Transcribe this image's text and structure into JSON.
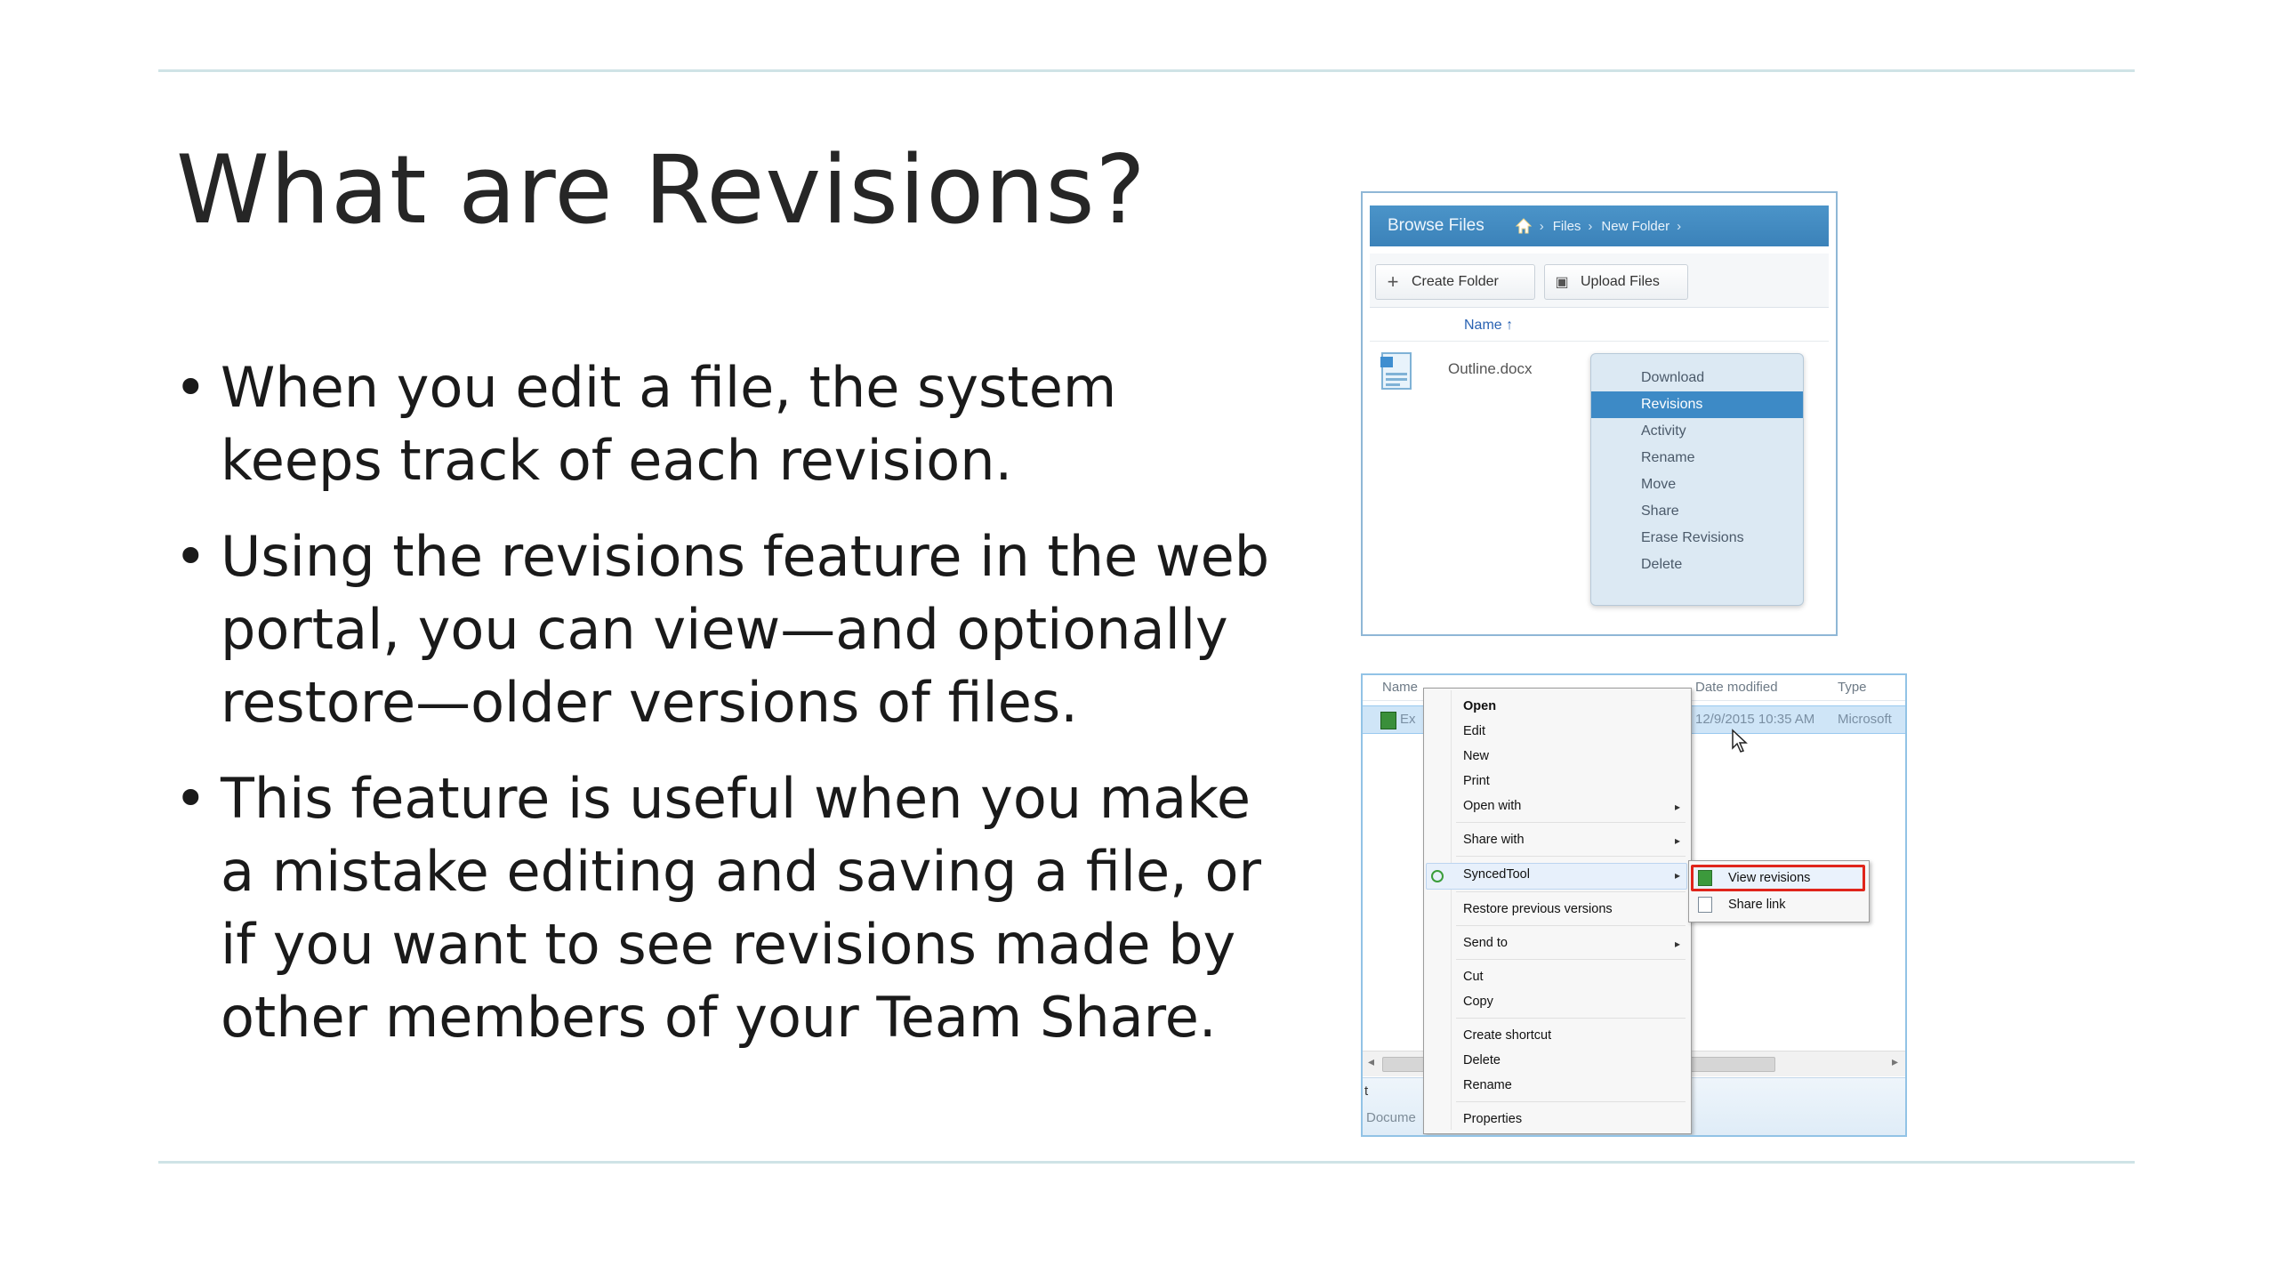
{
  "slide": {
    "title": "What are Revisions?",
    "bullet_symbol": "•",
    "bullets": [
      "When you edit a file, the system keeps track of each revision.",
      "Using the revisions feature in the web portal, you can view—and optionally restore—older versions of files.",
      "This feature is useful when you make a mistake editing and saving a file, or if you want to see revisions made by other members of your Team Share."
    ]
  },
  "portal": {
    "header_title": "Browse Files",
    "home_icon": "home-icon",
    "breadcrumb": [
      "Files",
      "New Folder"
    ],
    "breadcrumb_sep": "›",
    "buttons": {
      "create_folder": "Create Folder",
      "create_folder_icon": "+",
      "upload_files": "Upload Files",
      "upload_icon": "▣"
    },
    "column_name": "Name ↑",
    "file_name": "Outline.docx",
    "menu": {
      "items": [
        "Download",
        "Revisions",
        "Activity",
        "Rename",
        "Move",
        "Share",
        "Erase Revisions",
        "Delete"
      ],
      "selected": "Revisions"
    },
    "colors": {
      "header": "#3b82b9",
      "selected": "#3d8ac6",
      "menu_bg": "#dce9f3"
    }
  },
  "explorer": {
    "columns": {
      "name": "Name",
      "date_modified": "Date modified",
      "type": "Type"
    },
    "row": {
      "name_prefix": "Ex",
      "date": "12/9/2015 10:35 AM",
      "type": "Microsoft"
    },
    "context_menu": {
      "open": "Open",
      "edit": "Edit",
      "new": "New",
      "print": "Print",
      "open_with": "Open with",
      "share_with": "Share with",
      "syncedtool": "SyncedTool",
      "restore_previous": "Restore previous versions",
      "send_to": "Send to",
      "cut": "Cut",
      "copy": "Copy",
      "create_shortcut": "Create shortcut",
      "delete": "Delete",
      "rename": "Rename",
      "properties": "Properties",
      "submenu_arrow": "▸"
    },
    "submenu": {
      "view_revisions": "View revisions",
      "share_link": "Share link"
    },
    "scroll": {
      "left": "◂",
      "right": "▸"
    },
    "status": {
      "line1": "t",
      "line2": "Docume"
    },
    "colors": {
      "highlight_box": "#e0251b",
      "row_selected": "#cfe5f7"
    }
  }
}
